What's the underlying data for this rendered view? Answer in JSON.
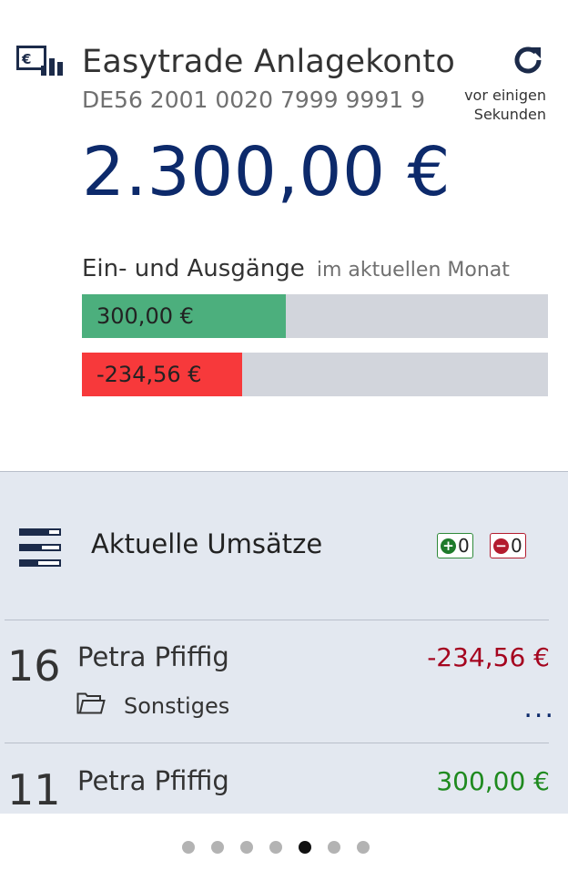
{
  "account": {
    "title": "Easytrade Anlagekonto",
    "iban": "DE56 2001 0020 7999 9991 9",
    "balance": "2.300,00 €",
    "icon": "euro-chart-icon",
    "refresh_icon": "refresh-icon",
    "refresh_time": "vor einigen\nSekunden"
  },
  "flows": {
    "title": "Ein- und Ausgänge",
    "subtitle": "im aktuellen Monat",
    "income_label": "300,00 €",
    "income_fraction": 0.437,
    "expense_label": "-234,56 €",
    "expense_fraction": 0.344,
    "colors": {
      "income": "#4caf7d",
      "expense": "#f7393b",
      "track": "#d2d5dc"
    }
  },
  "transactions": {
    "title": "Aktuelle Umsätze",
    "icon": "transactions-list-icon",
    "count_income": "0",
    "count_expense": "0",
    "items": [
      {
        "day": "16",
        "name": "Petra Pfiffig",
        "amount": "-234,56 €",
        "category": "Sonstiges",
        "category_icon": "folder-icon",
        "more": "..."
      },
      {
        "day": "11",
        "name": "Petra Pfiffig",
        "amount": "300,00 €"
      }
    ]
  },
  "pager": {
    "count": 7,
    "active_index": 4
  },
  "colors": {
    "accent": "#0d2a6b",
    "negative": "#a5051f",
    "positive": "#1f8a1f",
    "panel_bg": "#e3e8f0"
  }
}
